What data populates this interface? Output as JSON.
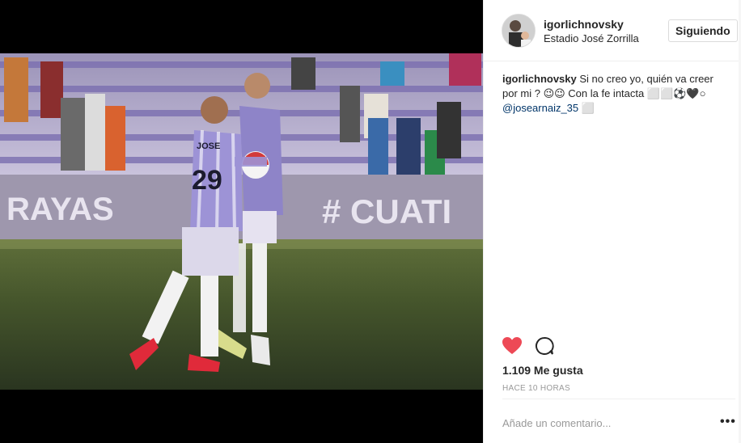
{
  "post": {
    "username": "igorlichnovsky",
    "location": "Estadio José Zorrilla",
    "follow_label": "Siguiendo",
    "caption": {
      "user": "igorlichnovsky",
      "text": "Si no creo yo, quién va creer por mi ? 😉😉 Con la fe intacta ⬜⬜⚽🖤○",
      "mention": "@josearnaiz_35",
      "tail": "⬜"
    },
    "likes": "1.109 Me gusta",
    "time": "HACE 10 HORAS",
    "comment_placeholder": "Añade un comentario...",
    "more_label": "•••"
  },
  "photo": {
    "banner_left": "RAYAS",
    "banner_right": "# CUATI",
    "player_number": "29",
    "player_name": "JOSE"
  },
  "colors": {
    "heart": "#ed4956",
    "mention": "#003569",
    "text": "#262626",
    "muted": "#999999"
  },
  "icons": [
    "heart-icon",
    "comment-icon",
    "more-icon"
  ]
}
